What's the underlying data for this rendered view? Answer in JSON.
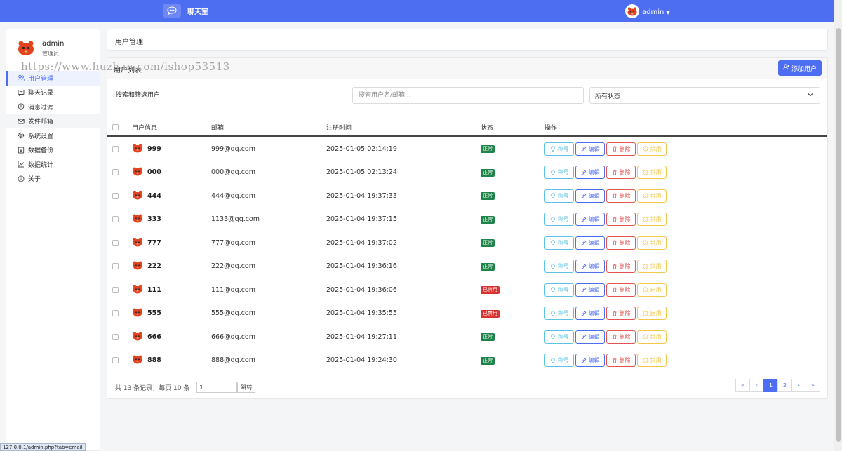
{
  "topbar": {
    "app_title": "聊天室",
    "user_name": "admin",
    "app_icon": "chat-bubble-icon"
  },
  "sidebar": {
    "profile": {
      "name": "admin",
      "role": "管理员"
    },
    "items": [
      {
        "label": "用户管理",
        "icon": "users-icon"
      },
      {
        "label": "聊天记录",
        "icon": "chat-log-icon"
      },
      {
        "label": "消息过滤",
        "icon": "shield-icon"
      },
      {
        "label": "发件邮箱",
        "icon": "mail-icon"
      },
      {
        "label": "系统设置",
        "icon": "gear-icon"
      },
      {
        "label": "数据备份",
        "icon": "backup-icon"
      },
      {
        "label": "数据统计",
        "icon": "chart-icon"
      },
      {
        "label": "关于",
        "icon": "info-icon"
      }
    ]
  },
  "page": {
    "title": "用户管理"
  },
  "card": {
    "title": "用户列表",
    "add_label": "添加用户"
  },
  "filter": {
    "label": "搜索和筛选用户",
    "search_placeholder": "搜索用户名/邮箱...",
    "status_value": "所有状态"
  },
  "table": {
    "headers": {
      "user": "用户信息",
      "email": "邮箱",
      "time": "注册时间",
      "status": "状态",
      "ops": "操作"
    },
    "rows": [
      {
        "name": "999",
        "email": "999@qq.com",
        "time": "2025-01-05 02:14:19",
        "status": "正常",
        "status_kind": "ok",
        "toggle": "禁用"
      },
      {
        "name": "000",
        "email": "000@qq.com",
        "time": "2025-01-05 02:13:24",
        "status": "正常",
        "status_kind": "ok",
        "toggle": "禁用"
      },
      {
        "name": "444",
        "email": "444@qq.com",
        "time": "2025-01-04 19:37:33",
        "status": "正常",
        "status_kind": "ok",
        "toggle": "禁用"
      },
      {
        "name": "333",
        "email": "1133@qq.com",
        "time": "2025-01-04 19:37:15",
        "status": "正常",
        "status_kind": "ok",
        "toggle": "禁用"
      },
      {
        "name": "777",
        "email": "777@qq.com",
        "time": "2025-01-04 19:37:02",
        "status": "正常",
        "status_kind": "ok",
        "toggle": "禁用"
      },
      {
        "name": "222",
        "email": "222@qq.com",
        "time": "2025-01-04 19:36:16",
        "status": "正常",
        "status_kind": "ok",
        "toggle": "禁用"
      },
      {
        "name": "111",
        "email": "111@qq.com",
        "time": "2025-01-04 19:36:06",
        "status": "已禁用",
        "status_kind": "off",
        "toggle": "启用"
      },
      {
        "name": "555",
        "email": "555@qq.com",
        "time": "2025-01-04 19:35:55",
        "status": "已禁用",
        "status_kind": "off",
        "toggle": "启用"
      },
      {
        "name": "666",
        "email": "666@qq.com",
        "time": "2025-01-04 19:27:11",
        "status": "正常",
        "status_kind": "ok",
        "toggle": "禁用"
      },
      {
        "name": "888",
        "email": "888@qq.com",
        "time": "2025-01-04 19:24:30",
        "status": "正常",
        "status_kind": "ok",
        "toggle": "禁用"
      }
    ],
    "op_labels": {
      "title": "称号",
      "edit": "编辑",
      "delete": "删除"
    }
  },
  "footer": {
    "summary": "共 13 条记录，每页 10 条",
    "page_input": "1",
    "jump_label": "跳转",
    "pages": [
      "«",
      "‹",
      "1",
      "2",
      "›",
      "»"
    ],
    "current_page": "1"
  },
  "status_url": "127.0.0.1/admin.php?tab=email",
  "watermark": "https://www.huzhan.com/ishop53513",
  "colors": {
    "accent": "#4e6ef2",
    "ok": "#1e8449",
    "off": "#d93030"
  }
}
